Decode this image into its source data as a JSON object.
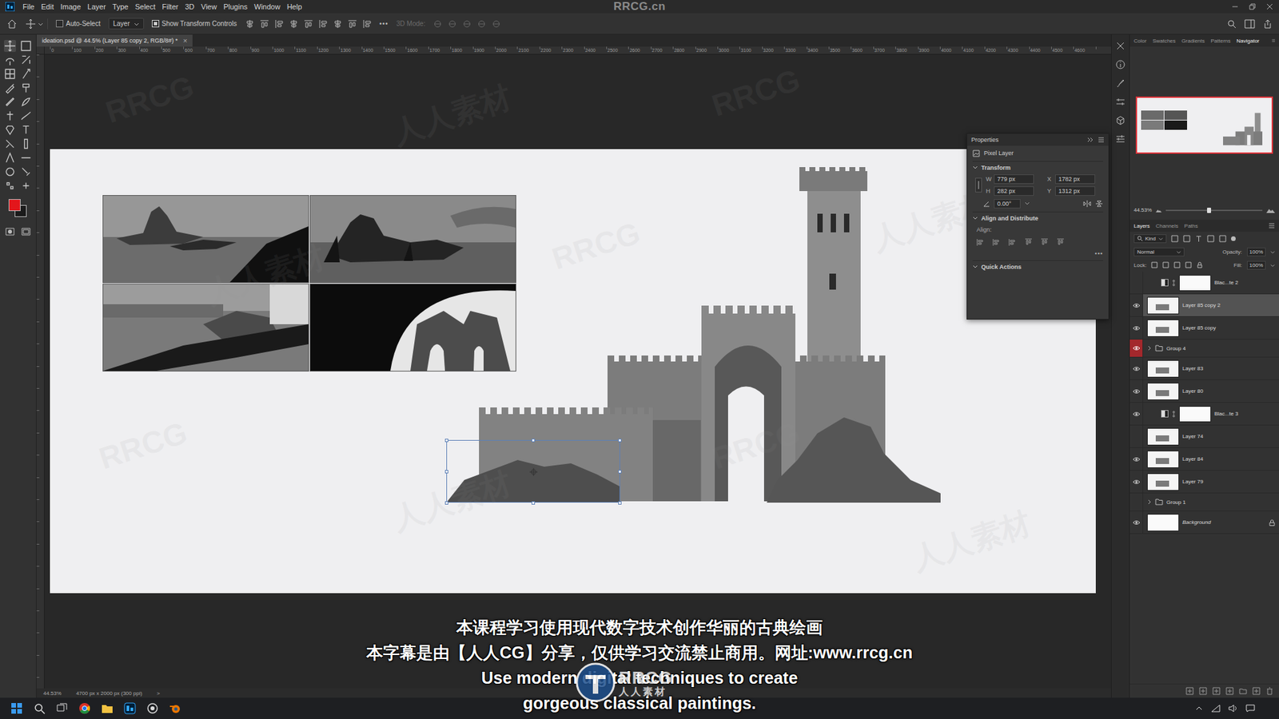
{
  "window": {
    "title": "RRCG.cn"
  },
  "menu": [
    "File",
    "Edit",
    "Image",
    "Layer",
    "Type",
    "Select",
    "Filter",
    "3D",
    "View",
    "Plugins",
    "Window",
    "Help"
  ],
  "options_bar": {
    "auto_select": {
      "label": "Auto-Select",
      "checked": false
    },
    "target": "Layer",
    "show_transform": {
      "label": "Show Transform Controls",
      "checked": true
    },
    "more": "•••",
    "mode_3d": "3D Mode:"
  },
  "document_tab": {
    "title": "ideation.psd @ 44.5% (Layer 85 copy 2, RGB/8#) *",
    "close": "×"
  },
  "ruler": {
    "top_labels": [
      "0",
      "100",
      "200",
      "300",
      "400",
      "500",
      "600",
      "700",
      "800",
      "900",
      "1000",
      "1100",
      "1200",
      "1300",
      "1400",
      "1500",
      "1600",
      "1700",
      "1800",
      "1900",
      "2000",
      "2100",
      "2200",
      "2300",
      "2400",
      "2500",
      "2600",
      "2700",
      "2800",
      "2900",
      "3000",
      "3100",
      "3200",
      "3300",
      "3400",
      "3500",
      "3600",
      "3700",
      "3800",
      "3900",
      "4000",
      "4100",
      "4200",
      "4300",
      "4400",
      "4500",
      "4600"
    ]
  },
  "tools": {
    "foreground": "#e3161b",
    "background": "#1b1b1b"
  },
  "properties": {
    "title": "Properties",
    "layer_kind": "Pixel Layer",
    "transform": {
      "title": "Transform",
      "w": {
        "label": "W",
        "value": "779 px"
      },
      "x": {
        "label": "X",
        "value": "1782 px"
      },
      "h": {
        "label": "H",
        "value": "282 px"
      },
      "y": {
        "label": "Y",
        "value": "1312 px"
      },
      "angle": "0.00°"
    },
    "align": {
      "title": "Align and Distribute",
      "label": "Align:"
    },
    "more": "•••",
    "quick_actions": "Quick Actions"
  },
  "navigator": {
    "tabs": [
      {
        "label": "Color",
        "selected": false
      },
      {
        "label": "Swatches",
        "selected": false
      },
      {
        "label": "Gradients",
        "selected": false
      },
      {
        "label": "Patterns",
        "selected": false
      },
      {
        "label": "Navigator",
        "selected": true
      }
    ],
    "zoom": "44.53%",
    "level": 0.45
  },
  "layers_panel": {
    "tabs": [
      {
        "label": "Layers",
        "selected": true
      },
      {
        "label": "Channels",
        "selected": false
      },
      {
        "label": "Paths",
        "selected": false
      }
    ],
    "filter": "Kind",
    "blend_mode": "Normal",
    "opacity": {
      "label": "Opacity:",
      "value": "100%"
    },
    "lock_label": "Lock:",
    "fill": {
      "label": "Fill:",
      "value": "100%"
    },
    "layers": [
      {
        "name": "Blac...te 2",
        "kind": "adjustment",
        "visible": false,
        "selected": false,
        "flagged": false,
        "locked": false
      },
      {
        "name": "Layer 85 copy 2",
        "kind": "pixel",
        "visible": true,
        "selected": true,
        "flagged": false,
        "locked": false
      },
      {
        "name": "Layer 85 copy",
        "kind": "pixel",
        "visible": true,
        "selected": false,
        "flagged": false,
        "locked": false
      },
      {
        "name": "Group 4",
        "kind": "group",
        "visible": true,
        "selected": false,
        "flagged": true,
        "locked": false
      },
      {
        "name": "Layer 83",
        "kind": "pixel",
        "visible": true,
        "selected": false,
        "flagged": false,
        "locked": false
      },
      {
        "name": "Layer 80",
        "kind": "pixel",
        "visible": true,
        "selected": false,
        "flagged": false,
        "locked": false
      },
      {
        "name": "Blac...te 3",
        "kind": "adjustment",
        "visible": true,
        "selected": false,
        "flagged": false,
        "locked": false
      },
      {
        "name": "Layer 74",
        "kind": "pixel",
        "visible": false,
        "selected": false,
        "flagged": false,
        "locked": false
      },
      {
        "name": "Layer 84",
        "kind": "pixel",
        "visible": true,
        "selected": false,
        "flagged": false,
        "locked": false
      },
      {
        "name": "Layer 79",
        "kind": "pixel",
        "visible": true,
        "selected": false,
        "flagged": false,
        "locked": false
      },
      {
        "name": "Group 1",
        "kind": "group",
        "visible": false,
        "selected": false,
        "flagged": false,
        "locked": false
      },
      {
        "name": "Background",
        "kind": "background",
        "visible": true,
        "selected": false,
        "flagged": false,
        "locked": true
      }
    ]
  },
  "status_bar": {
    "zoom": "44.53%",
    "doc_size": "4700 px x 2000 px (300 ppi)",
    "arrow": ">"
  },
  "subtitles": [
    "本课程学习使用现代数字技术创作华丽的古典绘画",
    "本字幕是由【人人CG】分享，仅供学习交流禁止商用。网址:www.rrcg.cn",
    "Use modern digital techniques to create",
    "gorgeous classical paintings."
  ],
  "logo": {
    "mark": "RRCG",
    "caption": "人人素材"
  },
  "watermark": [
    "RRCG",
    "人人素材"
  ]
}
